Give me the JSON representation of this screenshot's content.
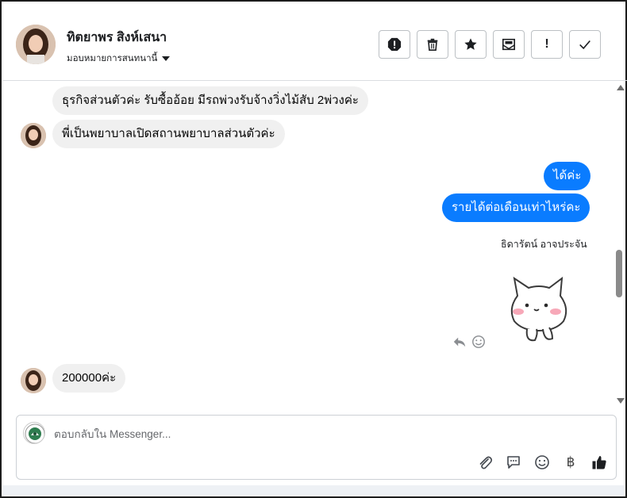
{
  "header": {
    "contact_name": "ทิตยาพร สิงห์เสนา",
    "assign_label": "มอบหมายการสนทนานี้",
    "toolbar": [
      {
        "icon": "report-spam-icon"
      },
      {
        "icon": "trash-icon"
      },
      {
        "icon": "star-icon"
      },
      {
        "icon": "mark-unread-icon"
      },
      {
        "icon": "follow-up-icon",
        "label": "!"
      },
      {
        "icon": "check-done-icon"
      }
    ]
  },
  "messages": {
    "m1": "ธุรกิจส่วนตัวค่ะ รับซื้ออ้อย มีรถพ่วงรับจ้างวิ่งไม้สับ 2พ่วงค่ะ",
    "m2": "พี่เป็นพยาบาลเปิดสถานพยาบาลส่วนตัวค่ะ",
    "m3": "ได้ค่ะ",
    "m4": "รายได้ต่อเดือนเท่าไหร่คะ",
    "sender_name": "ธิดารัตน์ อาจประจัน",
    "sticker": "cat-sticker",
    "m5": "200000ค่ะ"
  },
  "composer": {
    "placeholder": "ตอบกลับใน Messenger..."
  },
  "colors": {
    "outgoing_bubble": "#0a7cff",
    "incoming_bubble": "#f0f0f0",
    "thumbs_up": "#1c1e21"
  }
}
